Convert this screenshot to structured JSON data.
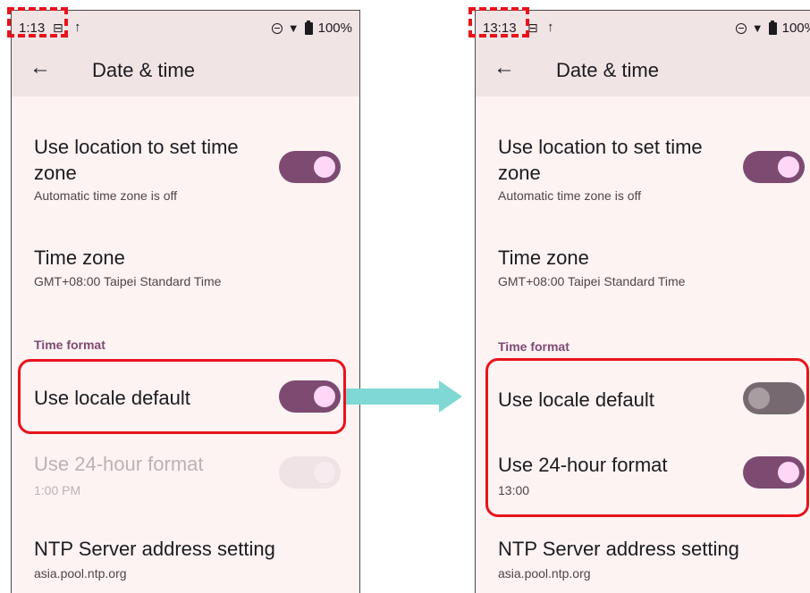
{
  "left": {
    "status": {
      "time": "1:13",
      "sim": "⊟",
      "upload": "↑",
      "wifi": "▼",
      "battery": "100%"
    },
    "header": {
      "back": "←",
      "title": "Date & time"
    },
    "location": {
      "title_line1": "Use location to set time",
      "title_line2": "zone",
      "summary": "Automatic time zone is off"
    },
    "timezone": {
      "title": "Time zone",
      "summary": "GMT+08:00 Taipei Standard Time"
    },
    "section": "Time format",
    "locale_default": {
      "title": "Use locale default"
    },
    "hour24": {
      "title": "Use 24-hour format",
      "summary": "1:00 PM"
    },
    "ntp": {
      "title": "NTP Server address setting",
      "summary": "asia.pool.ntp.org"
    }
  },
  "right": {
    "status": {
      "time": "13:13",
      "sim": "⊟",
      "upload": "↑",
      "wifi": "▼",
      "battery": "100%"
    },
    "header": {
      "back": "←",
      "title": "Date & time"
    },
    "location": {
      "title_line1": "Use location to set time",
      "title_line2": "zone",
      "summary": "Automatic time zone is off"
    },
    "timezone": {
      "title": "Time zone",
      "summary": "GMT+08:00 Taipei Standard Time"
    },
    "section": "Time format",
    "locale_default": {
      "title": "Use locale default"
    },
    "hour24": {
      "title": "Use 24-hour format",
      "summary": "13:00"
    },
    "ntp": {
      "title": "NTP Server address setting",
      "summary": "asia.pool.ntp.org"
    }
  },
  "colors": {
    "accent": "#7d4a72",
    "highlight": "#e8131b",
    "arrow": "#7fd8d4"
  }
}
